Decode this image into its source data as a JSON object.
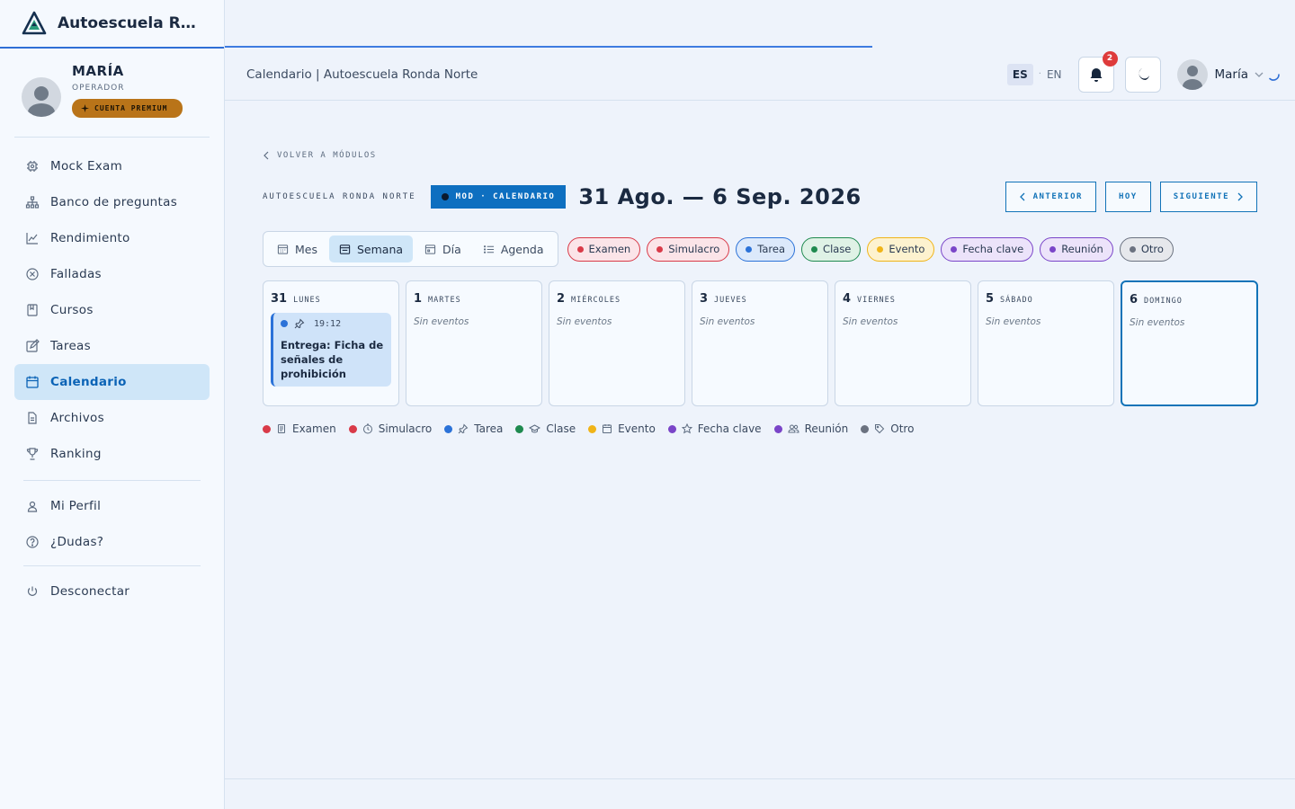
{
  "brand": {
    "name": "Autoescuela Ro..."
  },
  "user": {
    "name": "MARÍA",
    "role": "OPERADOR",
    "premium_label": "CUENTA PREMIUM"
  },
  "sidebar": {
    "items": [
      {
        "label": "Mock Exam",
        "icon": "chip-icon"
      },
      {
        "label": "Banco de preguntas",
        "icon": "hierarchy-icon"
      },
      {
        "label": "Rendimiento",
        "icon": "chart-up-icon"
      },
      {
        "label": "Falladas",
        "icon": "x-circle-icon"
      },
      {
        "label": "Cursos",
        "icon": "book-icon"
      },
      {
        "label": "Tareas",
        "icon": "edit-icon"
      },
      {
        "label": "Calendario",
        "icon": "calendar-icon",
        "active": true
      },
      {
        "label": "Archivos",
        "icon": "file-icon"
      },
      {
        "label": "Ranking",
        "icon": "trophy-icon"
      }
    ],
    "secondary": [
      {
        "label": "Mi Perfil",
        "icon": "user-icon"
      },
      {
        "label": "¿Dudas?",
        "icon": "help-icon"
      }
    ],
    "logout": {
      "label": "Desconectar",
      "icon": "power-icon"
    }
  },
  "header": {
    "title": "Calendario | Autoescuela Ronda Norte",
    "lang_active": "ES",
    "lang_sep": "·",
    "lang_other": "EN",
    "notifications": "2",
    "user_name": "María"
  },
  "main": {
    "back_label": "VOLVER A MÓDULOS",
    "org": "AUTOESCUELA RONDA NORTE",
    "module_tag": "MOD · CALENDARIO",
    "range": "31 Ago. — 6 Sep. 2026",
    "prev_label": "ANTERIOR",
    "today_label": "HOY",
    "next_label": "SIGUIENTE",
    "views": [
      {
        "label": "Mes",
        "active": false
      },
      {
        "label": "Semana",
        "active": true
      },
      {
        "label": "Día",
        "active": false
      },
      {
        "label": "Agenda",
        "active": false
      }
    ],
    "filters": [
      {
        "label": "Examen",
        "color": "#d93a48",
        "bg": "#fbe4e8",
        "border": "#d93a48"
      },
      {
        "label": "Simulacro",
        "color": "#d93a48",
        "bg": "#fbe4e8",
        "border": "#d93a48"
      },
      {
        "label": "Tarea",
        "color": "#2b72d8",
        "bg": "#dce9fb",
        "border": "#2b72d8"
      },
      {
        "label": "Clase",
        "color": "#1f8a4f",
        "bg": "#dff2e6",
        "border": "#1f8a4f"
      },
      {
        "label": "Evento",
        "color": "#f0b418",
        "bg": "#fdf2cf",
        "border": "#f0b418"
      },
      {
        "label": "Fecha clave",
        "color": "#7a45c8",
        "bg": "#ece3fa",
        "border": "#7a45c8"
      },
      {
        "label": "Reunión",
        "color": "#7a45c8",
        "bg": "#ece3fa",
        "border": "#7a45c8"
      },
      {
        "label": "Otro",
        "color": "#6b7280",
        "bg": "#e6e8ec",
        "border": "#6b7280"
      }
    ],
    "days": [
      {
        "num": "31",
        "name": "LUNES",
        "events": [
          {
            "time": "19:12",
            "title": "Entrega: Ficha de señales de prohibición",
            "icon": "pin-icon"
          }
        ]
      },
      {
        "num": "1",
        "name": "MARTES",
        "events": []
      },
      {
        "num": "2",
        "name": "MIÉRCOLES",
        "events": []
      },
      {
        "num": "3",
        "name": "JUEVES",
        "events": []
      },
      {
        "num": "4",
        "name": "VIERNES",
        "events": []
      },
      {
        "num": "5",
        "name": "SÁBADO",
        "events": []
      },
      {
        "num": "6",
        "name": "DOMINGO",
        "events": [],
        "today": true
      }
    ],
    "no_events": "Sin eventos",
    "legend": [
      {
        "label": "Examen",
        "color": "#d93a48",
        "icon": "document-icon"
      },
      {
        "label": "Simulacro",
        "color": "#d93a48",
        "icon": "timer-icon"
      },
      {
        "label": "Tarea",
        "color": "#2b72d8",
        "icon": "pin-icon"
      },
      {
        "label": "Clase",
        "color": "#1f8a4f",
        "icon": "graduation-icon"
      },
      {
        "label": "Evento",
        "color": "#f0b418",
        "icon": "calendar-icon"
      },
      {
        "label": "Fecha clave",
        "color": "#7a45c8",
        "icon": "star-icon"
      },
      {
        "label": "Reunión",
        "color": "#7a45c8",
        "icon": "group-icon"
      },
      {
        "label": "Otro",
        "color": "#6b7280",
        "icon": "tag-icon"
      }
    ]
  }
}
